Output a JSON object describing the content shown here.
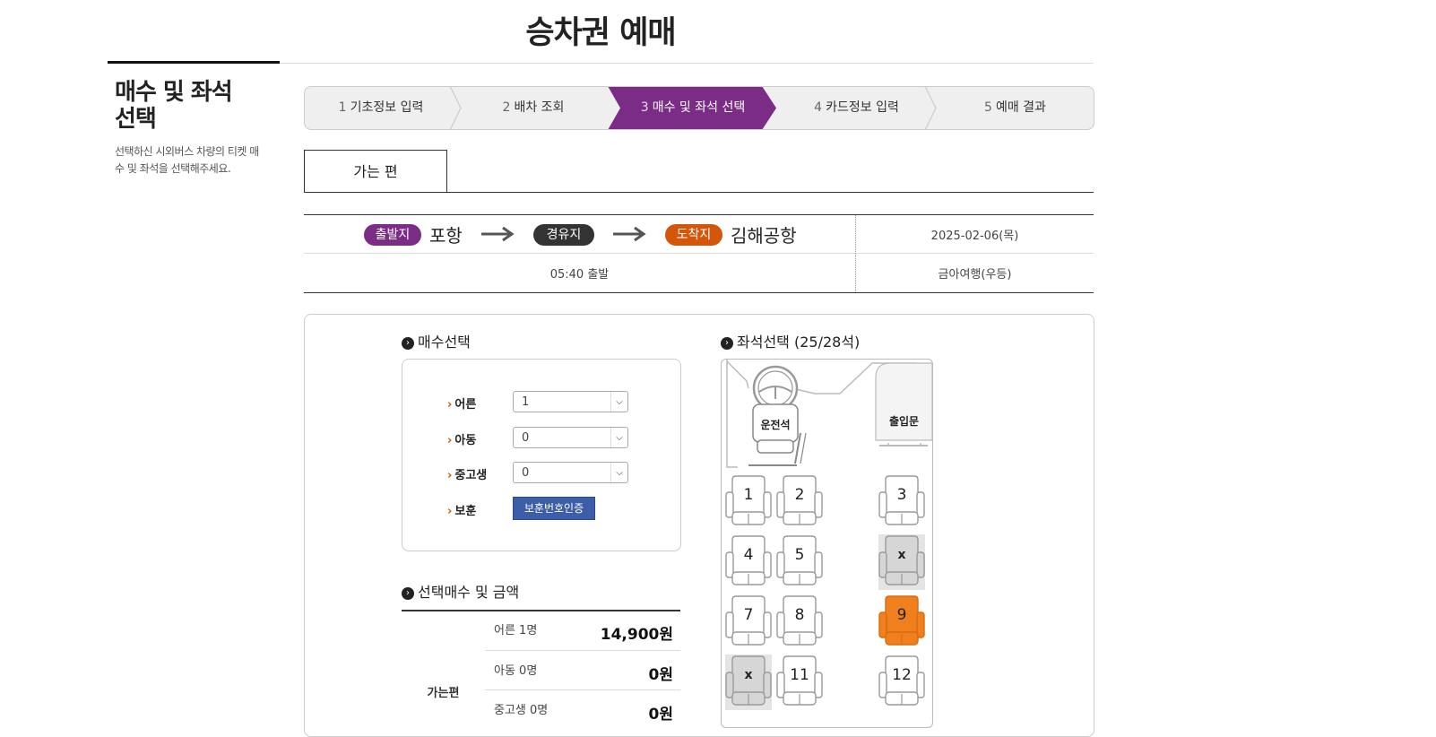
{
  "page": {
    "title": "승차권 예매"
  },
  "side": {
    "title_line1": "매수 및 좌석",
    "title_line2": "선택",
    "desc_line1": "선택하신 시외버스 차량의 티켓 매",
    "desc_line2": "수 및 좌석을 선택해주세요."
  },
  "steps": [
    {
      "num": "1",
      "label": "기초정보 입력"
    },
    {
      "num": "2",
      "label": "배차 조회"
    },
    {
      "num": "3",
      "label": "매수 및 좌석 선택"
    },
    {
      "num": "4",
      "label": "카드정보 입력"
    },
    {
      "num": "5",
      "label": "예매 결과"
    }
  ],
  "tab": {
    "label": "가는 편"
  },
  "route": {
    "origin_tag": "출발지",
    "origin": "포항",
    "via_tag": "경유지",
    "dest_tag": "도착지",
    "dest": "김해공항",
    "date": "2025-02-06(목)",
    "time": "05:40 출발",
    "grade": "금아여행(우등)"
  },
  "qty": {
    "title": "매수선택",
    "adult_label": "어른",
    "adult_value": "1",
    "child_label": "아동",
    "child_value": "0",
    "teen_label": "중고생",
    "teen_value": "0",
    "vet_label": "보훈",
    "vet_button": "보훈번호인증"
  },
  "price": {
    "title": "선택매수 및 금액",
    "side_label": "가는편",
    "rows": [
      {
        "label": "어른 1명",
        "value": "14,900원"
      },
      {
        "label": "아동 0명",
        "value": "0원"
      },
      {
        "label": "중고생 0명",
        "value": "0원"
      }
    ]
  },
  "seats": {
    "title": "좌석선택 (25/28석)",
    "driver_label": "운전석",
    "door_label": "출입문",
    "taken_mark": "x",
    "list": [
      {
        "label": "1",
        "state": "available"
      },
      {
        "label": "2",
        "state": "available"
      },
      {
        "label": "3",
        "state": "available"
      },
      {
        "label": "4",
        "state": "available"
      },
      {
        "label": "5",
        "state": "available"
      },
      {
        "label": "x",
        "state": "taken"
      },
      {
        "label": "7",
        "state": "available"
      },
      {
        "label": "8",
        "state": "available"
      },
      {
        "label": "9",
        "state": "selected"
      },
      {
        "label": "x",
        "state": "taken"
      },
      {
        "label": "11",
        "state": "available"
      },
      {
        "label": "12",
        "state": "available"
      }
    ]
  },
  "colors": {
    "accent": "#7b2d86",
    "dest": "#d4560b",
    "selected_seat": "#f0801e",
    "button": "#3c5ea8"
  }
}
